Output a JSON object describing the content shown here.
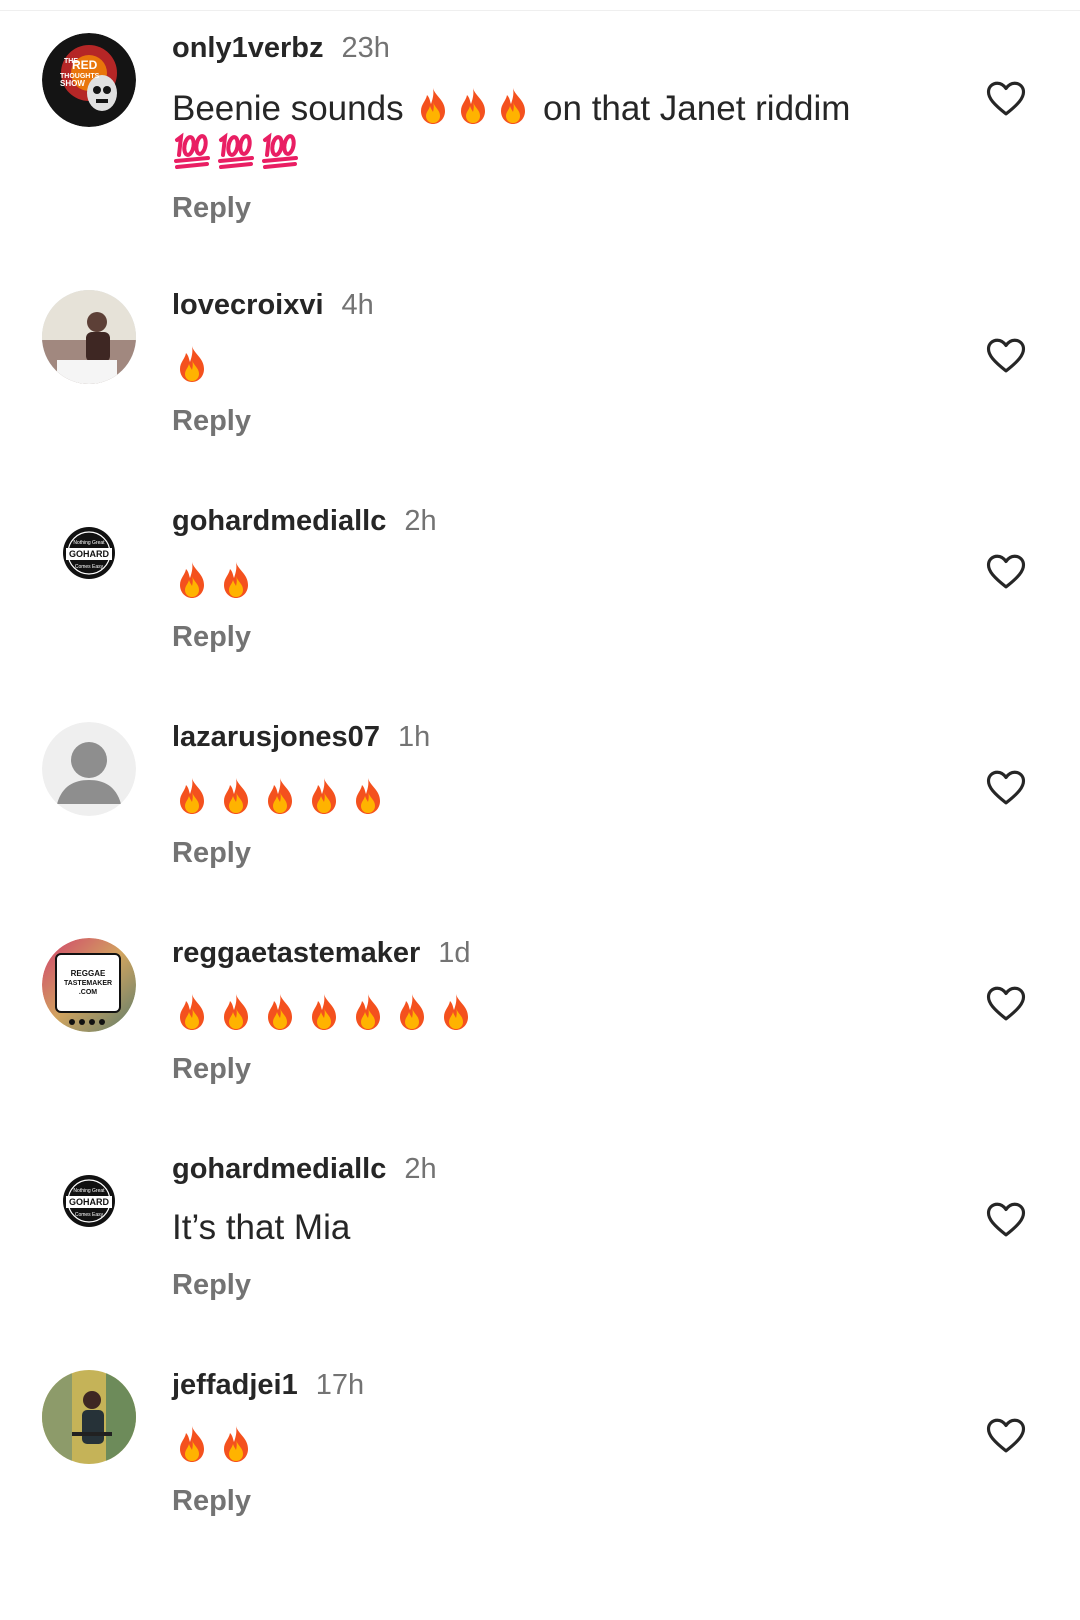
{
  "comments": [
    {
      "username": "only1verbz",
      "time": "23h",
      "text_before": "Beenie sounds",
      "fire_count": 3,
      "text_after": "on that Janet riddim",
      "hundred_count": 3,
      "reply_label": "Reply",
      "avatar_text": [
        "THE",
        "RED",
        "THOUGHTS",
        "SHOW"
      ]
    },
    {
      "username": "lovecroixvi",
      "time": "4h",
      "fire_count": 1,
      "reply_label": "Reply"
    },
    {
      "username": "gohardmediallc",
      "time": "2h",
      "fire_count": 2,
      "reply_label": "Reply",
      "avatar_text": [
        "Nothing Great",
        "GOHARD",
        "Comes Easy"
      ]
    },
    {
      "username": "lazarusjones07",
      "time": "1h",
      "fire_count": 5,
      "reply_label": "Reply"
    },
    {
      "username": "reggaetastemaker",
      "time": "1d",
      "fire_count": 7,
      "reply_label": "Reply",
      "avatar_text": [
        "REGGAE",
        "TASTEMAKER",
        ".COM"
      ]
    },
    {
      "username": "gohardmediallc",
      "time": "2h",
      "text": "It’s that Mia",
      "reply_label": "Reply",
      "avatar_text": [
        "Nothing Great",
        "GOHARD",
        "Comes Easy"
      ]
    },
    {
      "username": "jeffadjei1",
      "time": "17h",
      "fire_count": 2,
      "reply_label": "Reply"
    }
  ],
  "icons": {
    "like": "heart-outline-icon",
    "reaction": "fire-emoji",
    "score": "hundred-points-emoji"
  },
  "colors": {
    "username": "#262626",
    "meta": "#737373",
    "fire_outer": "#f4511e",
    "fire_inner": "#ffb300",
    "hundred": "#e91e63"
  }
}
